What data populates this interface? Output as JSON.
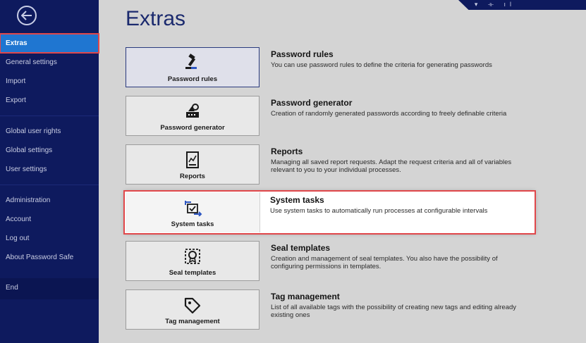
{
  "sidebar": {
    "items": [
      {
        "label": "Extras",
        "active": true
      },
      {
        "label": "General settings"
      },
      {
        "label": "Import"
      },
      {
        "label": "Export"
      },
      {
        "label": "Global user rights"
      },
      {
        "label": "Global settings"
      },
      {
        "label": "User settings"
      },
      {
        "label": "Administration"
      },
      {
        "label": "Account"
      },
      {
        "label": "Log out"
      },
      {
        "label": "About Password Safe"
      },
      {
        "label": "End"
      }
    ]
  },
  "main": {
    "title": "Extras",
    "modules": [
      {
        "tile_label": "Password rules",
        "heading": "Password rules",
        "description": "You can use password rules to define the criteria for generating passwords",
        "icon": "gavel-icon"
      },
      {
        "tile_label": "Password generator",
        "heading": "Password generator",
        "description": "Creation of randomly generated passwords according to freely definable criteria",
        "icon": "generator-icon"
      },
      {
        "tile_label": "Reports",
        "heading": "Reports",
        "description": "Managing all saved report requests. Adapt the request criteria and all of variables relevant to you to your individual processes.",
        "icon": "report-icon"
      },
      {
        "tile_label": "System tasks",
        "heading": "System tasks",
        "description": "Use system tasks to automatically run processes at configurable intervals",
        "icon": "system-tasks-icon"
      },
      {
        "tile_label": "Seal templates",
        "heading": "Seal templates",
        "description": "Creation and management of seal templates. You also have the possibility of configuring permissions in templates.",
        "icon": "seal-icon"
      },
      {
        "tile_label": "Tag management",
        "heading": "Tag management",
        "description": "List of all available tags with the possibility of creating new tags and editing already existing ones",
        "icon": "tag-icon"
      }
    ]
  },
  "colors": {
    "sidebar_bg": "#0e1a5e",
    "active_item": "#1f76d1",
    "highlight_border": "#e0474a",
    "title": "#1b2a6e"
  }
}
